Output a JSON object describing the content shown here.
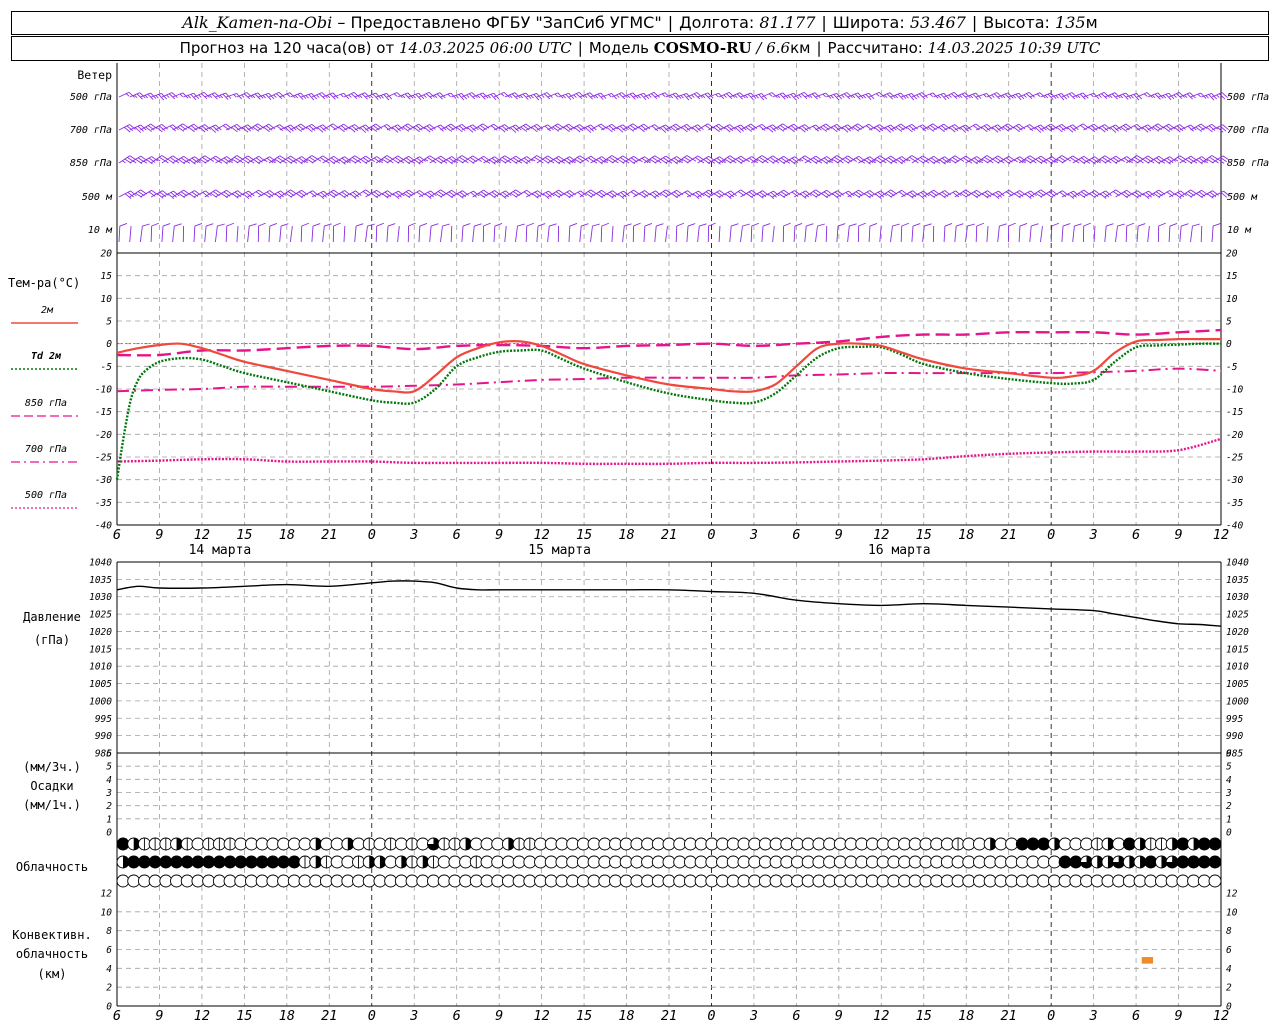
{
  "header": {
    "station": "Alk_Kamen-na-Obi",
    "provider_prefix": "– Предоставлено ФГБУ \"ЗапСиб УГМС\"",
    "lon_label": "Долгота:",
    "lon_value": "81.177",
    "lat_label": "Широта:",
    "lat_value": "53.467",
    "alt_label": "Высота:",
    "alt_value": "135",
    "alt_unit": "м",
    "forecast_label": "Прогноз на 120 часа(ов) от",
    "forecast_time": "14.03.2025 06:00 UTC",
    "model_label": "Модель",
    "model_name": "COSMO-RU",
    "model_res": "/ 6.6",
    "model_res_unit": "км",
    "calc_label": "Рассчитано:",
    "calc_time": "14.03.2025 10:39 UTC"
  },
  "colors": {
    "wind": "#8a2be2",
    "t2m": "#f0483c",
    "td2m": "#00780a",
    "t850": "#e6148c",
    "t700": "#e6148c",
    "t500": "#e6148c",
    "zero_line": "#3a3aff",
    "pressure": "#000000",
    "convective": "#f08c28",
    "grid": "#a0a0a0"
  },
  "chart_data": [
    {
      "type": "barbs",
      "ylabel": "Ветер",
      "levels": [
        "500 гПа",
        "700 гПа",
        "850 гПа",
        "500 м",
        "10 м"
      ]
    },
    {
      "type": "line",
      "ylabel": "Тем-ра(°C)",
      "ylim": [
        -40,
        20
      ],
      "yticks": [
        20,
        15,
        10,
        5,
        0,
        -5,
        -10,
        -15,
        -20,
        -25,
        -30,
        -35,
        -40
      ],
      "x_hours": [
        6,
        9,
        12,
        15,
        18,
        21,
        24,
        27,
        30,
        33,
        36,
        39,
        42,
        45,
        48,
        51,
        54,
        57,
        60,
        63,
        66,
        69,
        72,
        75,
        78,
        81,
        84
      ],
      "xtick_labels": [
        "6",
        "9",
        "12",
        "15",
        "18",
        "21",
        "0",
        "3",
        "6",
        "9",
        "12",
        "15",
        "18",
        "21",
        "0",
        "3",
        "6",
        "9",
        "12",
        "15",
        "18",
        "21",
        "0",
        "3",
        "6",
        "9",
        "12"
      ],
      "dates": [
        {
          "x": 12,
          "label": "14 марта"
        },
        {
          "x": 36,
          "label": "15 марта"
        },
        {
          "x": 60,
          "label": "16 марта"
        }
      ],
      "series": [
        {
          "name": "2м",
          "style": "solid",
          "x": [
            6,
            7.5,
            9,
            10.5,
            12,
            13.5,
            15,
            18,
            21,
            24,
            25.5,
            27,
            28.5,
            30,
            31.5,
            33,
            34.5,
            36,
            37.5,
            39,
            42,
            45,
            48,
            49.5,
            51,
            52.5,
            54,
            55.5,
            57,
            58.5,
            60,
            61.5,
            63,
            66,
            69,
            72,
            73.5,
            75,
            76.5,
            78,
            79.5,
            81,
            82.5,
            84
          ],
          "y": [
            -2,
            -1,
            -0.3,
            0,
            -1,
            -2.5,
            -4,
            -6,
            -8,
            -10,
            -10.5,
            -10.5,
            -7,
            -3,
            -1,
            0.3,
            0.5,
            -0.5,
            -2.5,
            -4.5,
            -7,
            -9,
            -10,
            -10.5,
            -10.5,
            -9,
            -5,
            -1,
            0,
            0,
            -0.5,
            -2,
            -3.5,
            -5.5,
            -6.5,
            -7.5,
            -7.2,
            -6,
            -2,
            0.5,
            0.8,
            1,
            1,
            1
          ]
        },
        {
          "name": "Td 2м",
          "style": "dotted",
          "x": [
            6,
            6.5,
            7,
            7.5,
            8,
            9,
            10.5,
            12,
            13.5,
            15,
            18,
            21,
            24,
            25.5,
            27,
            28.5,
            30,
            31.5,
            33,
            34.5,
            36,
            37.5,
            39,
            42,
            45,
            48,
            49.5,
            51,
            52.5,
            54,
            55.5,
            57,
            58.5,
            60,
            61.5,
            63,
            66,
            69,
            72,
            73.5,
            75,
            76.5,
            78,
            79.5,
            81,
            82.5,
            84
          ],
          "y": [
            -30,
            -20,
            -12,
            -8,
            -6,
            -4,
            -3.2,
            -3.5,
            -5,
            -6.5,
            -8.5,
            -10.5,
            -12.5,
            -13,
            -13,
            -10,
            -5,
            -3,
            -1.8,
            -1.5,
            -1.5,
            -3.5,
            -5.5,
            -8.5,
            -11,
            -12.5,
            -13,
            -13,
            -11,
            -7,
            -3,
            -1,
            -0.7,
            -0.8,
            -2.5,
            -4.5,
            -6.5,
            -7.8,
            -8.7,
            -8.8,
            -8,
            -4,
            -0.8,
            -0.4,
            -0.2,
            0,
            0
          ]
        },
        {
          "name": "850 гПа",
          "style": "dashed",
          "x": [
            6,
            9,
            12,
            15,
            18,
            21,
            24,
            27,
            30,
            33,
            36,
            39,
            42,
            45,
            48,
            51,
            54,
            57,
            60,
            63,
            66,
            69,
            72,
            75,
            78,
            81,
            84
          ],
          "y": [
            -2.5,
            -2.5,
            -1.5,
            -1.5,
            -1,
            -0.5,
            -0.5,
            -1.2,
            -0.5,
            -0.3,
            -0.5,
            -1,
            -0.5,
            -0.3,
            0,
            -0.5,
            0,
            0.5,
            1.5,
            2,
            2,
            2.5,
            2.5,
            2.5,
            2,
            2.5,
            3
          ]
        },
        {
          "name": "700 гПа",
          "style": "dashdot",
          "x": [
            6,
            9,
            12,
            15,
            18,
            21,
            24,
            27,
            30,
            33,
            36,
            39,
            42,
            45,
            48,
            51,
            54,
            57,
            60,
            63,
            66,
            69,
            72,
            75,
            78,
            81,
            84
          ],
          "y": [
            -10.5,
            -10.2,
            -10,
            -9.5,
            -9.5,
            -9.5,
            -9.5,
            -9.3,
            -9,
            -8.5,
            -8,
            -7.8,
            -7.5,
            -7.5,
            -7.5,
            -7.5,
            -7,
            -6.8,
            -6.5,
            -6.5,
            -6.5,
            -6.5,
            -6.5,
            -6.3,
            -6,
            -5.5,
            -6
          ]
        },
        {
          "name": "500 гПа",
          "style": "dotted",
          "x": [
            6,
            9,
            12,
            15,
            18,
            21,
            24,
            27,
            30,
            33,
            36,
            39,
            42,
            45,
            48,
            51,
            54,
            57,
            60,
            63,
            66,
            69,
            72,
            75,
            78,
            81,
            84
          ],
          "y": [
            -26,
            -25.8,
            -25.5,
            -25.5,
            -26,
            -26,
            -26,
            -26.3,
            -26.3,
            -26.3,
            -26.3,
            -26.5,
            -26.5,
            -26.5,
            -26.3,
            -26.3,
            -26.2,
            -26,
            -25.8,
            -25.5,
            -24.8,
            -24.3,
            -24,
            -23.8,
            -23.8,
            -23.5,
            -21
          ]
        }
      ]
    },
    {
      "type": "line",
      "ylabel": "Давление",
      "yunit": "(гПа)",
      "ylim": [
        985,
        1040
      ],
      "yticks": [
        1040,
        1035,
        1030,
        1025,
        1020,
        1015,
        1010,
        1005,
        1000,
        995,
        990,
        985
      ],
      "series": [
        {
          "name": "",
          "x": [
            6,
            7.5,
            9,
            12,
            15,
            18,
            21,
            24,
            25.5,
            27,
            28.5,
            30,
            31.5,
            33,
            36,
            39,
            42,
            45,
            48,
            51,
            54,
            57,
            60,
            63,
            66,
            69,
            72,
            75,
            76.5,
            78,
            79.5,
            81,
            82.5,
            84
          ],
          "y": [
            1032,
            1033,
            1032.5,
            1032.5,
            1033,
            1033.5,
            1033,
            1034,
            1034.5,
            1034.5,
            1034,
            1032.5,
            1032,
            1032,
            1032,
            1032,
            1032,
            1032,
            1031.5,
            1031,
            1029,
            1028,
            1027.5,
            1028,
            1027.5,
            1027,
            1026.5,
            1026,
            1025,
            1024,
            1023,
            1022.2,
            1022,
            1021.5
          ]
        }
      ]
    },
    {
      "type": "bar",
      "ylabel_top": "(мм/3ч.)",
      "ylabel": "Осадки",
      "ylabel_bottom": "(мм/1ч.)",
      "ylim": [
        0,
        6
      ],
      "yticks": [
        6,
        5,
        4,
        3,
        2,
        1,
        0
      ],
      "values": []
    },
    {
      "type": "symbols",
      "ylabel": "Облачность",
      "rows": [
        "4211121011100000002002010101031120002110000000000000000000000000000000000000001002004442000120421124244",
        "2444444444444444412100122021210001000000000000000000000000000000000000000000000000000000443223224234444",
        "0000000000000000000000000000000000000000000000000000000000000000000000000000000000000000000000000000000"
      ]
    },
    {
      "type": "bar",
      "ylabel": "Конвективн.",
      "ylabel2": "облачность",
      "yunit": "(км)",
      "ylim": [
        0,
        12
      ],
      "yticks": [
        12,
        10,
        8,
        6,
        4,
        2,
        0
      ],
      "bars": [
        {
          "x0": 78.4,
          "x1": 79.2,
          "y0": 4.5,
          "y1": 5.2
        }
      ]
    }
  ]
}
